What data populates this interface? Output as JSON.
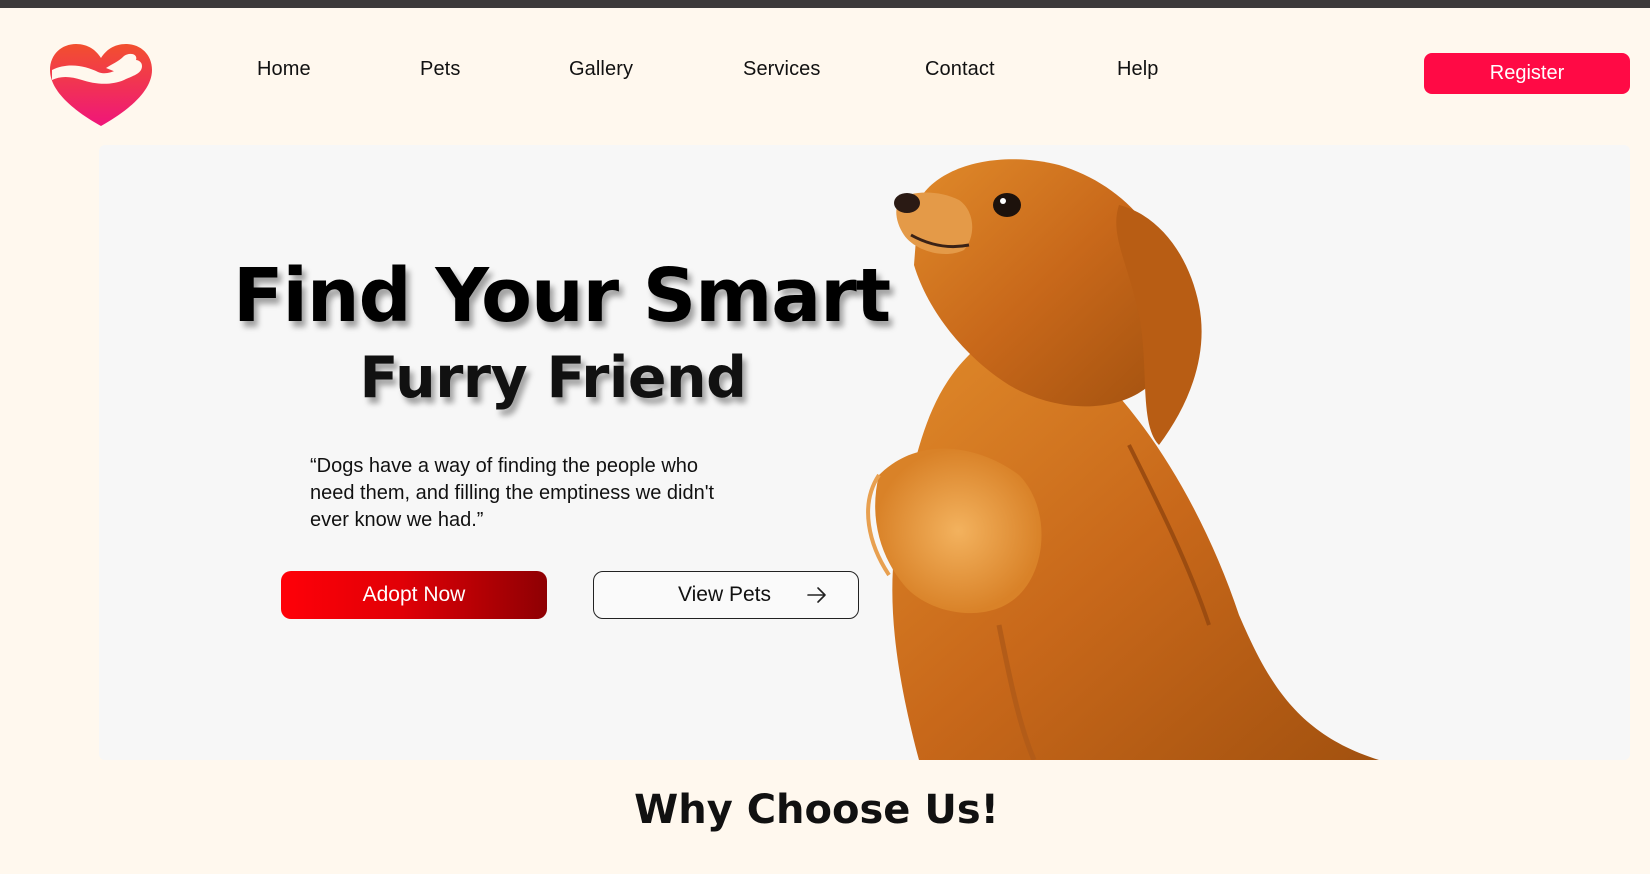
{
  "nav": {
    "items": [
      {
        "label": "Home"
      },
      {
        "label": "Pets"
      },
      {
        "label": "Gallery"
      },
      {
        "label": "Services"
      },
      {
        "label": "Contact"
      },
      {
        "label": "Help"
      }
    ],
    "register_label": "Register"
  },
  "hero": {
    "title": "Find Your Smart",
    "subtitle": "Furry Friend",
    "quote": "“Dogs have a way of finding the people who need them, and filling the emptiness we didn't ever know we had.”",
    "adopt_label": "Adopt Now",
    "view_label": "View Pets"
  },
  "section": {
    "title": "Why Choose Us!"
  },
  "colors": {
    "accent": "#ff0a45",
    "adopt_gradient_start": "#ff0008",
    "adopt_gradient_end": "#8e0003",
    "page_bg": "#fff8ee",
    "topbar": "#3d3a3a"
  },
  "icons": {
    "logo": "heart-hand-logo-icon",
    "arrow": "arrow-right-icon"
  }
}
